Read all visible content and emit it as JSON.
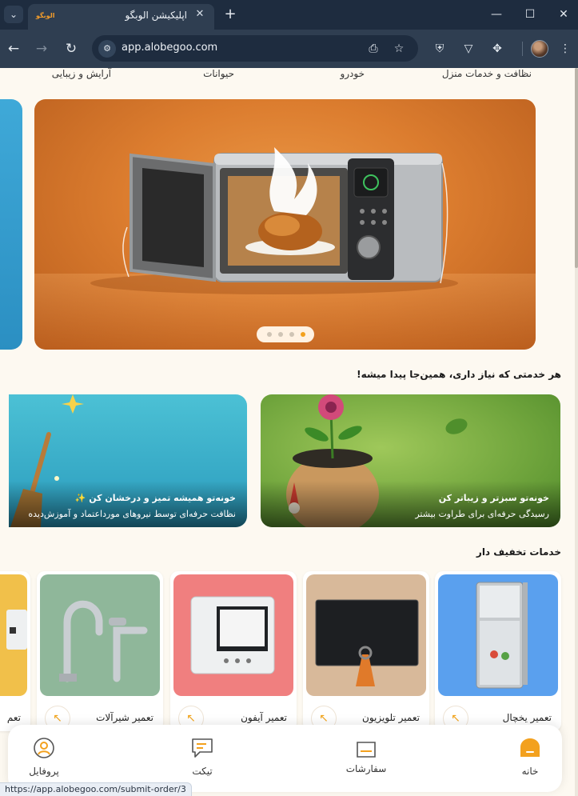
{
  "browser": {
    "tab_title": "اپلیکیشن الوبگو",
    "favicon_text": "الوبگو",
    "url": "app.alobegoo.com",
    "status_url": "https://app.alobegoo.com/submit-order/3"
  },
  "categories": [
    "نظافت و خدمات منزل",
    "خودرو",
    "حیوانات",
    "آرایش و زیبایی"
  ],
  "carousel": {
    "total": 4,
    "active_index": 4
  },
  "sections": {
    "promo_title": "هر خدمتی که نیاز داری، همین‌جا پیدا میشه!",
    "discount_title": "خدمات تخفیف دار"
  },
  "promos": [
    {
      "title": "خونه‌تو سبزتر و زیباتر کن",
      "subtitle": "رسیدگی حرفه‌ای برای طراوت بیشتر"
    },
    {
      "title": "خونه‌تو همیشه تمیز و درخشان کن ✨",
      "subtitle": "نظافت حرفه‌ای توسط نیروهای مورداعتماد و آموزش‌دیده"
    }
  ],
  "services": [
    {
      "title": "تعمیر یخچال",
      "bg": "#5aa0ee"
    },
    {
      "title": "تعمیر تلویزیون",
      "bg": "#d8b99a"
    },
    {
      "title": "تعمیر آیفون",
      "bg": "#f07f7f"
    },
    {
      "title": "تعمیر شیرآلات",
      "bg": "#8fb79a"
    },
    {
      "title": "تعم",
      "bg": "#f1c04a"
    }
  ],
  "bottom_nav": [
    {
      "label": "خانه",
      "icon": "home-icon",
      "active": true
    },
    {
      "label": "سفارشات",
      "icon": "orders-icon",
      "active": false
    },
    {
      "label": "تیکت",
      "icon": "ticket-icon",
      "active": false
    },
    {
      "label": "پروفایل",
      "icon": "profile-icon",
      "active": false
    }
  ],
  "colors": {
    "accent": "#f3a11e",
    "page_bg": "#fdf9f1",
    "chrome_bg": "#1e2c3f"
  }
}
